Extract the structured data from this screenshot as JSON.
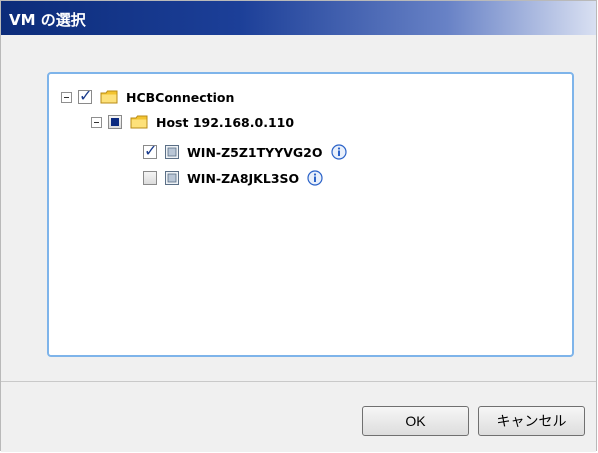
{
  "dialog": {
    "title": "VM の選択"
  },
  "tree": {
    "root": {
      "label": "HCBConnection",
      "checked": true,
      "expanded": true
    },
    "host": {
      "label": "Host 192.168.0.110",
      "state": "partial",
      "expanded": true
    },
    "vms": [
      {
        "label": "WIN-Z5Z1TYYVG2O",
        "checked": true
      },
      {
        "label": "WIN-ZA8JKL3SO",
        "checked": false
      }
    ]
  },
  "buttons": {
    "ok": "OK",
    "cancel": "キャンセル"
  },
  "icons": {
    "checkmark": "✓"
  },
  "colors": {
    "title_bar": "#0c2c7a",
    "tree_border": "#7eb4ea",
    "check_mark": "#1a3b8c",
    "folder": "#f3c430",
    "info": "#2a62c8"
  }
}
